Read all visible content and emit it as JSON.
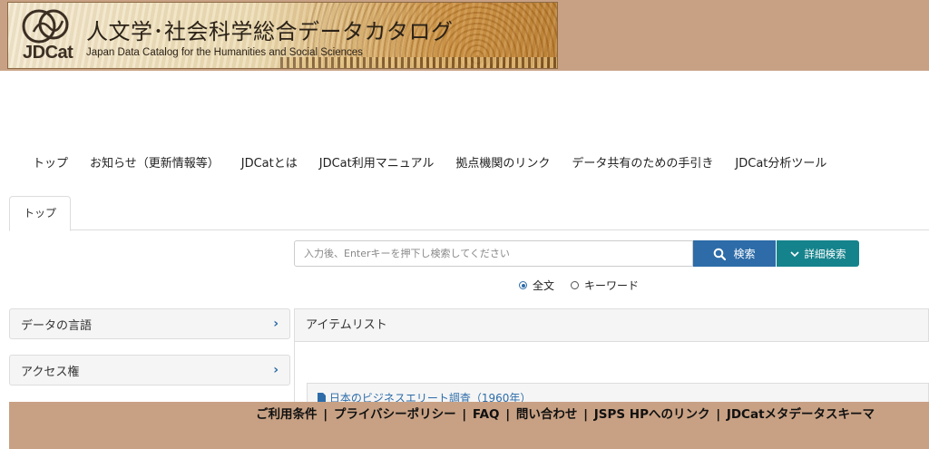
{
  "header": {
    "logo_text": "JDCat",
    "title_jp": "人文学･社会科学総合データカタログ",
    "title_en": "Japan Data Catalog for the Humanities and Social Sciences"
  },
  "nav": {
    "items": [
      {
        "label": "トップ"
      },
      {
        "label": "お知らせ（更新情報等）"
      },
      {
        "label": "JDCatとは"
      },
      {
        "label": "JDCat利用マニュアル"
      },
      {
        "label": "拠点機関のリンク"
      },
      {
        "label": "データ共有のための手引き"
      },
      {
        "label": "JDCat分析ツール"
      }
    ]
  },
  "tabs": [
    {
      "label": "トップ"
    }
  ],
  "search": {
    "placeholder": "入力後、Enterキーを押下し検索してください",
    "value": "",
    "search_button": "検索",
    "advanced_button": "詳細検索",
    "options": [
      {
        "label": "全文",
        "selected": true
      },
      {
        "label": "キーワード",
        "selected": false
      }
    ]
  },
  "facets": [
    {
      "label": "データの言語"
    },
    {
      "label": "アクセス権"
    }
  ],
  "item_list": {
    "heading": "アイテムリスト",
    "items": [
      {
        "title": "日本のビジネスエリート調査（1960年）"
      }
    ]
  },
  "footer": {
    "links": [
      {
        "label": "ご利用条件"
      },
      {
        "label": "プライバシーポリシー"
      },
      {
        "label": "FAQ"
      },
      {
        "label": "問い合わせ"
      },
      {
        "label": "JSPS HPへのリンク"
      },
      {
        "label": "JDCatメタデータスキーマ"
      }
    ]
  },
  "colors": {
    "brand_brown": "#c8a184",
    "primary_blue": "#2d6ca8",
    "teal": "#15838c"
  },
  "icons": [
    "search-icon",
    "chevron-down-icon",
    "chevron-right-icon",
    "file-icon"
  ]
}
